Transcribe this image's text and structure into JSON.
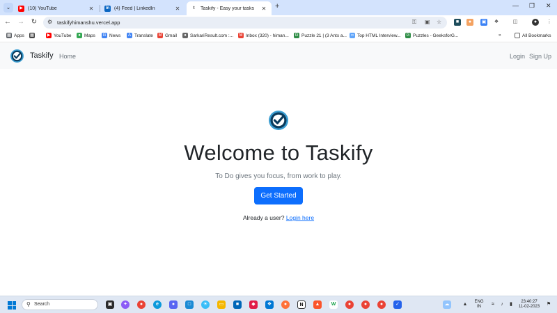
{
  "browser": {
    "tabs": [
      {
        "title": "(10) YouTube",
        "active": false
      },
      {
        "title": "(4) Feed | LinkedIn",
        "active": false
      },
      {
        "title": "Taskify - Easy your tasks",
        "active": true
      }
    ],
    "url": "taskifyhimanshu.vercel.app",
    "bookmarks": [
      "Apps",
      "YouTube",
      "Maps",
      "News",
      "Translate",
      "Gmail",
      "SarkariResult.com :...",
      "Inbox (320) - himan...",
      "Puzzle 21 | (3 Ants a...",
      "Top HTML Interview...",
      "Puzzles - GeeksforG..."
    ],
    "all_bookmarks": "All Bookmarks"
  },
  "navbar": {
    "brand": "Taskify",
    "home": "Home",
    "login": "Login",
    "signup": "Sign Up"
  },
  "hero": {
    "title": "Welcome to Taskify",
    "subtitle": "To Do gives you focus, from work to play.",
    "cta": "Get Started",
    "already_prefix": "Already a user?",
    "login_link": "Login here"
  },
  "taskbar": {
    "search_placeholder": "Search",
    "lang": "ENG",
    "region": "IN",
    "time": "23:40:27",
    "date": "11-02-2023"
  },
  "colors": {
    "primary": "#0d6efd",
    "tabstrip": "#d3e3fd",
    "navbar_bg": "#f8f9fa"
  }
}
